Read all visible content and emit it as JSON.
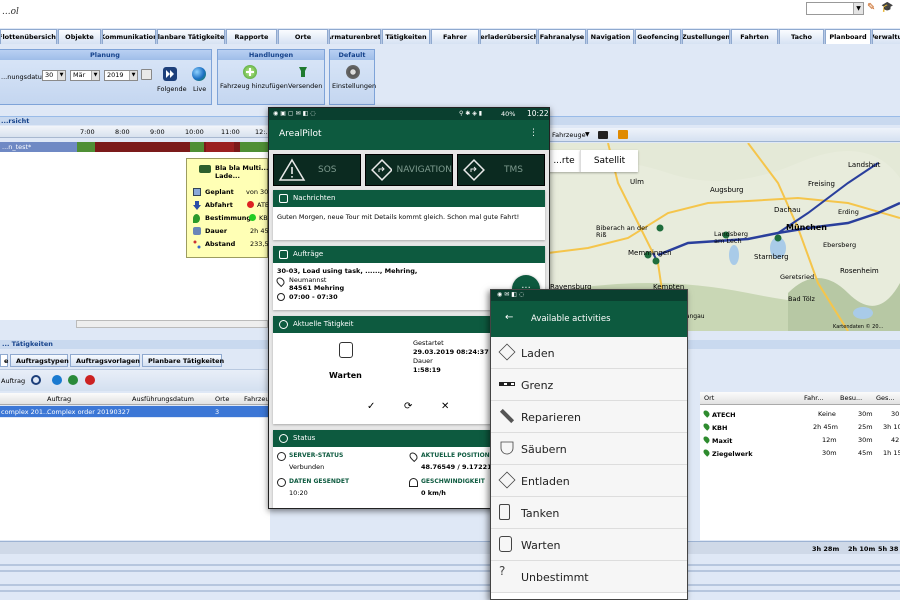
{
  "topbar": {
    "logo": "...ol",
    "pencil": "✎",
    "hat": "🎓"
  },
  "tabs": [
    "Flottenübersicht",
    "Objekte",
    "Kommunikation",
    "Planbare Tätigkeiten",
    "Rapporte",
    "Orte",
    "Armaturenbrett",
    "Tätigkeiten",
    "Fahrer",
    "Verladerübersicht",
    "Fahranalyse",
    "Navigation",
    "Geofencing",
    "Zustellungen",
    "Fahrten",
    "Tacho",
    "Planboard",
    "Verwaltu..."
  ],
  "planung": {
    "group_title": "Planung",
    "date_label": "...nungsdatum",
    "day": "30",
    "month": "Mär",
    "year": "2019",
    "next_label": "Folgende",
    "live_label": "Live"
  },
  "handlungen": {
    "group_title": "Handlungen",
    "add_label": "Fahrzeug hinzufügen",
    "send_label": "Versenden"
  },
  "default_group": {
    "group_title": "Default",
    "settings_label": "Einstellungen"
  },
  "uebersicht": {
    "title": "...rsicht",
    "times": [
      "7:00",
      "8:00",
      "9:00",
      "10:00",
      "11:00",
      "12:..."
    ],
    "row_label": "...n_test*"
  },
  "tooltip": {
    "title": "Bla bla Multi... Lade...",
    "rows": [
      {
        "label": "Geplant",
        "value": "von 30..."
      },
      {
        "label": "Abfahrt",
        "value": "ATECH..."
      },
      {
        "label": "Bestimmung",
        "value": "KBH..."
      },
      {
        "label": "Dauer",
        "value": "2h 45..."
      },
      {
        "label": "Abstand",
        "value": "233,5..."
      }
    ]
  },
  "taetigkeiten": {
    "title": "... Tätigkeiten",
    "subtabs": [
      "e",
      "Auftragstypen",
      "Auftragsvorlagen",
      "Planbare Tätigkeiten"
    ],
    "toolbar_label": "Auftrag",
    "columns": [
      "Auftrag",
      "Ausführungsdatum",
      "Orte",
      "Fahrzeu..."
    ],
    "row": {
      "c0": "complex 201...",
      "c1": "Complex order 20190327",
      "c2": "",
      "c3": "3"
    }
  },
  "ort_table": {
    "columns": [
      "Ort",
      "Fahr...",
      "Besu...",
      "Ges..."
    ],
    "rows": [
      {
        "ort": "ATECH",
        "fahr": "Keine",
        "besu": "30m",
        "ges": "30"
      },
      {
        "ort": "KBH",
        "fahr": "2h 45m",
        "besu": "25m",
        "ges": "3h 10"
      },
      {
        "ort": "Maxit",
        "fahr": "12m",
        "besu": "30m",
        "ges": "42"
      },
      {
        "ort": "Ziegelwerk",
        "fahr": "30m",
        "besu": "45m",
        "ges": "1h 15"
      }
    ],
    "totals": {
      "fahr": "3h 28m",
      "besu": "2h 10m",
      "ges": "5h 38"
    }
  },
  "map": {
    "vehicles_label": "Fahrzeuge",
    "map_btn": "...rte",
    "satellite_btn": "Satellit",
    "cities": [
      "Ulm",
      "Augsburg",
      "Freising",
      "Landshut",
      "Dachau",
      "München",
      "Biberach an der Riß",
      "Memmingen",
      "Landsberg am Lech",
      "Starnberg",
      "Kempten",
      "Rosenheim",
      "Ravensburg",
      "Schwangau",
      "Geretsried",
      "Bad Tölz",
      "Ebersberg",
      "Erding"
    ],
    "copyright": "Kartendaten © 20..."
  },
  "phone1": {
    "time": "10:22",
    "battery": "40%",
    "app_title": "ArealPilot",
    "buttons": [
      "SOS",
      "NAVIGATION",
      "TMS"
    ],
    "messages_title": "Nachrichten",
    "message": "Guten Morgen, neue Tour mit Details kommt gleich. Schon mal gute Fahrt!",
    "orders_title": "Aufträge",
    "order_line": "30-03, Load using task, ......, Mehring,",
    "order_place": "Neumannst",
    "order_city": "84561 Mehring",
    "order_time": "07:00 - 07:30",
    "activity_title": "Aktuelle Tätigkeit",
    "activity": "Warten",
    "started_label": "Gestartet",
    "started_value": "29.03.2019 08:24:37",
    "duration_label": "Dauer",
    "duration_value": "1:58:19",
    "status_title": "Status",
    "server_label": "SERVER-STATUS",
    "server_value": "Verbunden",
    "position_label": "AKTUELLE POSITION",
    "position_value": "48.76549 / 9.17221",
    "sent_label": "DATEN GESENDET",
    "sent_value": "10:20",
    "speed_label": "GESCHWINDIGKEIT",
    "speed_value": "0 km/h",
    "fab": "..."
  },
  "phone2": {
    "title": "Available activities",
    "activities": [
      "Laden",
      "Grenz",
      "Reparieren",
      "Säubern",
      "Entladen",
      "Tanken",
      "Warten",
      "Unbestimmt"
    ]
  },
  "colors": {
    "app_green": "#0d5a3f",
    "status_green": "#0a3f2f",
    "selection_blue": "#3c77d6",
    "tab_border": "#8fa9cf"
  }
}
